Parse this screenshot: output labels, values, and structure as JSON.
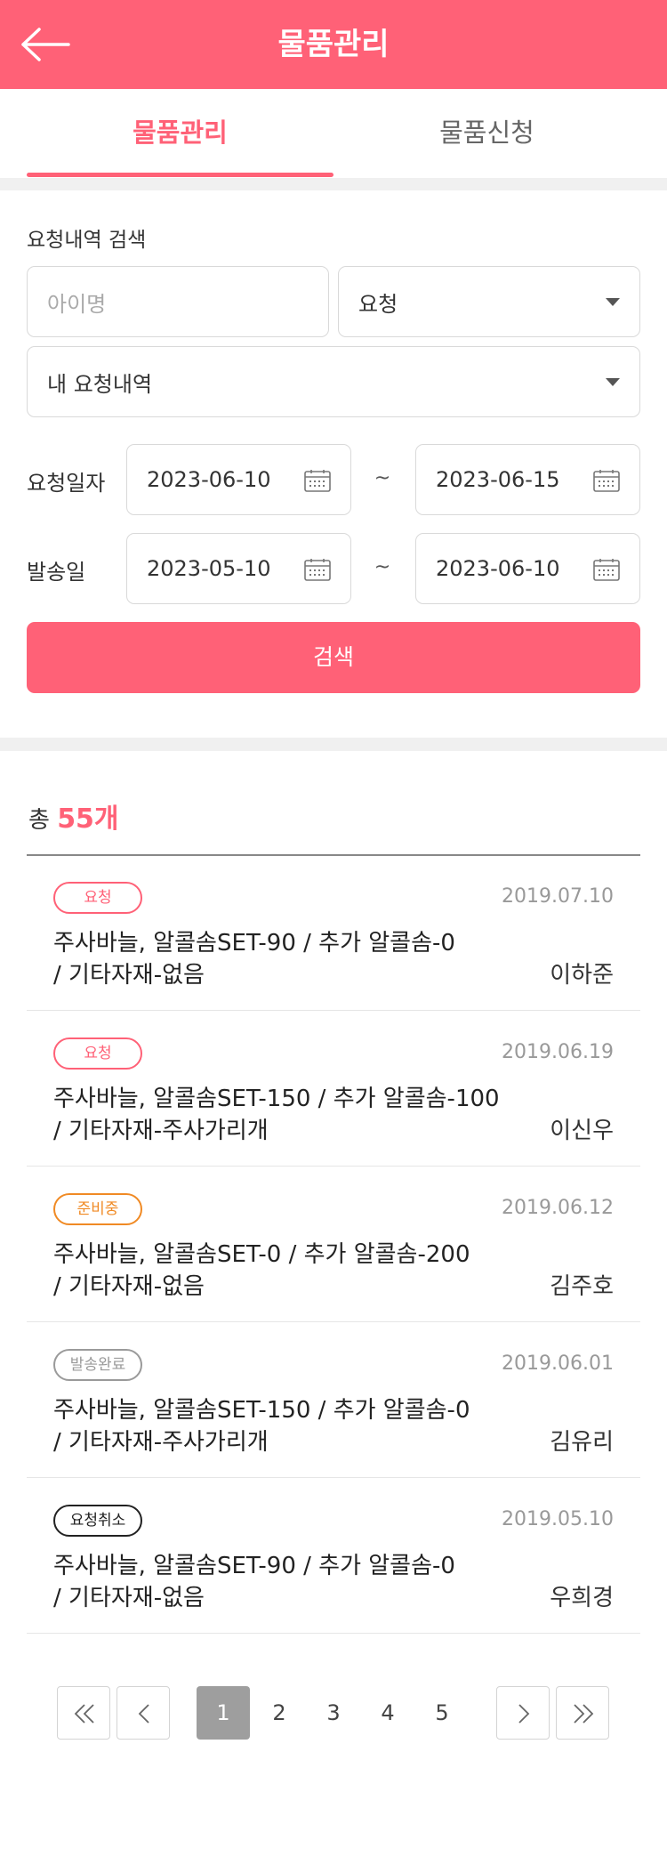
{
  "header": {
    "title": "물품관리"
  },
  "tabs": [
    {
      "label": "물품관리",
      "active": true
    },
    {
      "label": "물품신청",
      "active": false
    }
  ],
  "search": {
    "section_label": "요청내역 검색",
    "name_placeholder": "아이명",
    "status_select": "요청",
    "scope_select": "내 요청내역",
    "request_date": {
      "label": "요청일자",
      "from": "2023-06-10",
      "to": "2023-06-15"
    },
    "ship_date": {
      "label": "발송일",
      "from": "2023-05-10",
      "to": "2023-06-10"
    },
    "range_sep": "~",
    "button_label": "검색"
  },
  "total": {
    "prefix": "총",
    "count": "55개"
  },
  "items": [
    {
      "status": "요청",
      "status_color": "#ff6177",
      "date": "2019.07.10",
      "line1": "주사바늘, 알콜솜SET-90 / 추가 알콜솜-0",
      "line2": "/ 기타자재-없음",
      "name": "이하준"
    },
    {
      "status": "요청",
      "status_color": "#ff6177",
      "date": "2019.06.19",
      "line1": "주사바늘, 알콜솜SET-150 / 추가 알콜솜-100",
      "line2": "/ 기타자재-주사가리개",
      "name": "이신우"
    },
    {
      "status": "준비중",
      "status_color": "#f08a24",
      "date": "2019.06.12",
      "line1": "주사바늘, 알콜솜SET-0 / 추가 알콜솜-200",
      "line2": "/ 기타자재-없음",
      "name": "김주호"
    },
    {
      "status": "발송완료",
      "status_color": "#9a9a9a",
      "date": "2019.06.01",
      "line1": "주사바늘, 알콜솜SET-150 / 추가 알콜솜-0",
      "line2": "/ 기타자재-주사가리개",
      "name": "김유리"
    },
    {
      "status": "요청취소",
      "status_color": "#222222",
      "date": "2019.05.10",
      "line1": "주사바늘, 알콜솜SET-90 / 추가 알콜솜-0",
      "line2": "/ 기타자재-없음",
      "name": "우희경"
    }
  ],
  "pagination": {
    "pages": [
      "1",
      "2",
      "3",
      "4",
      "5"
    ],
    "current": "1",
    "icons": [
      "double-chevron-left-icon",
      "chevron-left-icon",
      "chevron-right-icon",
      "double-chevron-right-icon"
    ]
  },
  "colors": {
    "accent": "#ff6177",
    "separator": "#f0f0f0"
  }
}
